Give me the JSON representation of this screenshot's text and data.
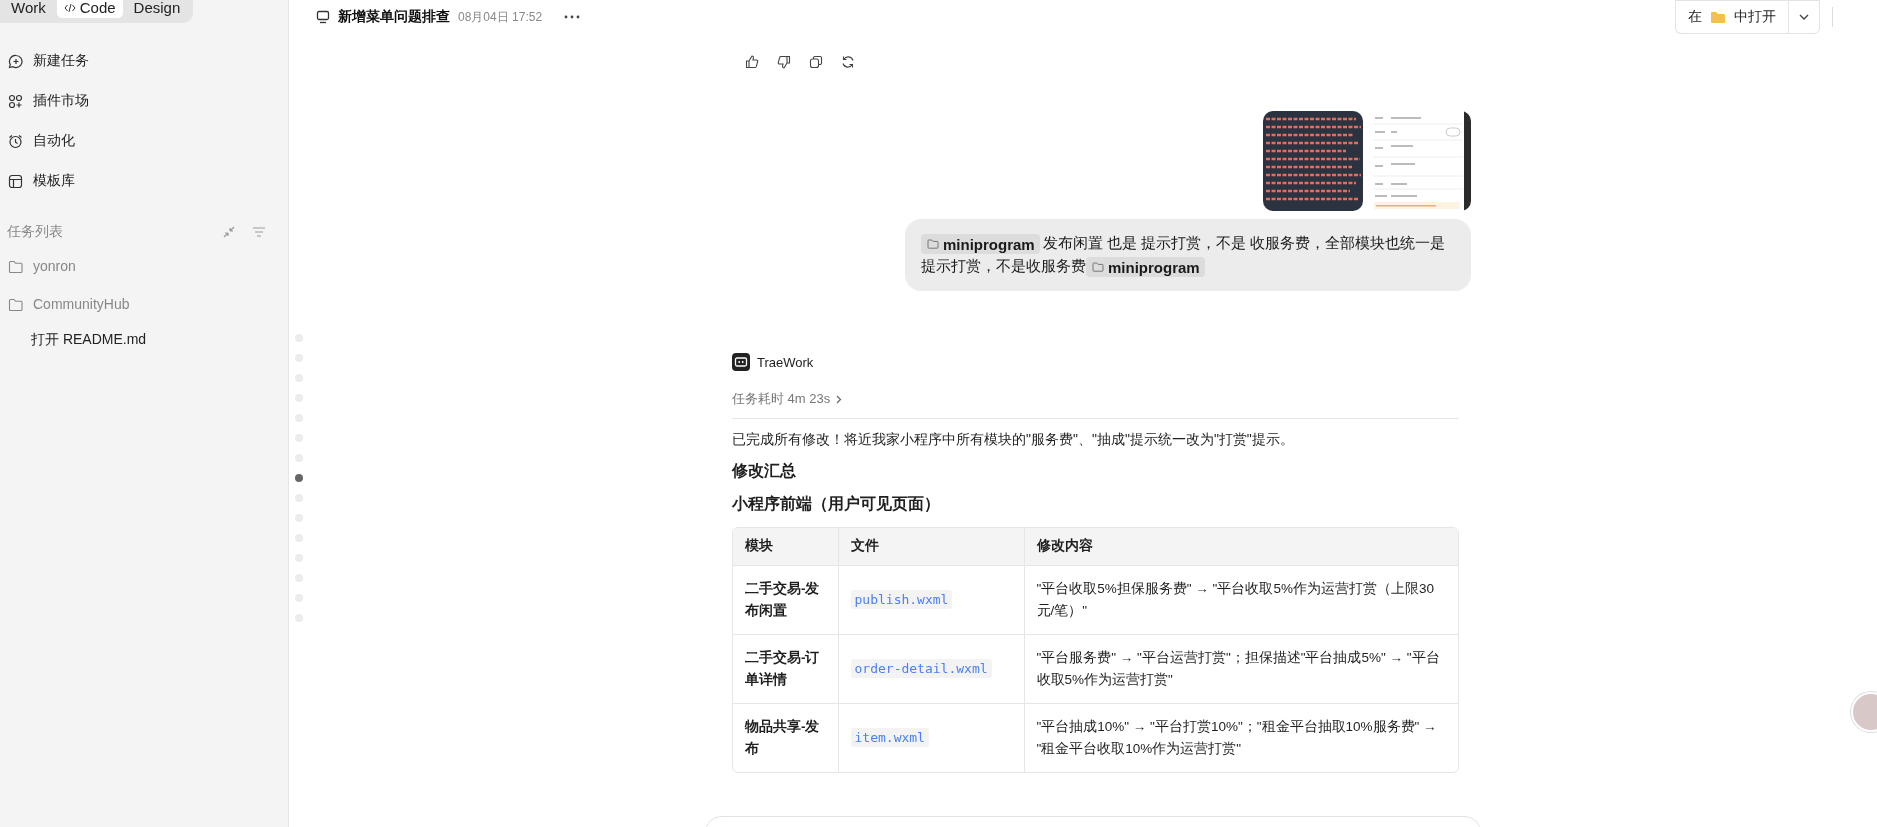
{
  "mode_tabs": [
    {
      "label": "Work",
      "selected": false,
      "kind": "plain"
    },
    {
      "label": "Code",
      "selected": true,
      "kind": "with_icon"
    },
    {
      "label": "Design",
      "selected": false,
      "kind": "plain"
    }
  ],
  "sidebar": {
    "nav_items": [
      {
        "label": "新建任务"
      },
      {
        "label": "插件市场"
      },
      {
        "label": "自动化"
      },
      {
        "label": "模板库"
      }
    ],
    "task_list": {
      "title": "任务列表",
      "items": [
        {
          "label": "yonron"
        },
        {
          "label": "CommunityHub",
          "children": [
            {
              "label": "打开 README.md"
            }
          ]
        }
      ]
    }
  },
  "header": {
    "title": "新增菜单问题排查",
    "time": "08月04日 17:52",
    "open_in": {
      "prefix": "在",
      "suffix": "中打开"
    }
  },
  "nav_dots": [
    {
      "selected": false
    },
    {
      "selected": false
    },
    {
      "selected": false
    },
    {
      "selected": false
    },
    {
      "selected": false
    },
    {
      "selected": false
    },
    {
      "selected": false
    },
    {
      "selected": true
    },
    {
      "selected": false
    },
    {
      "selected": false
    },
    {
      "selected": false
    },
    {
      "selected": false
    },
    {
      "selected": false
    },
    {
      "selected": false
    },
    {
      "selected": false
    }
  ],
  "user_message": {
    "parts": [
      {
        "kind": "folder_tag",
        "text": "miniprogram"
      },
      {
        "kind": "text",
        "text": "发布闲置 也是 提示打赏，不是 收服务费，全部模块也统一是提示打赏，不是收服务费"
      },
      {
        "kind": "folder_tag",
        "text": "miniprogram"
      }
    ]
  },
  "assistant": {
    "name": "TraeWork",
    "duration": "任务耗时 4m 23s",
    "summary": "已完成所有修改！将近我家小程序中所有模块的\"服务费\"、\"抽成\"提示统一改为\"打赏\"提示。",
    "headings": [
      "修改汇总",
      "小程序前端（用户可见页面）"
    ],
    "table": {
      "columns": [
        "模块",
        "文件",
        "修改内容"
      ],
      "rows": [
        {
          "module": "二手交易-发布闲置",
          "file": "publish.wxml",
          "change": "\"平台收取5%担保服务费\" → \"平台收取5%作为运营打赏（上限30元/笔）\""
        },
        {
          "module": "二手交易-订单详情",
          "file": "order-detail.wxml",
          "change": "\"平台服务费\" → \"平台运营打赏\"；担保描述\"平台抽成5%\" → \"平台收取5%作为运营打赏\""
        },
        {
          "module": "物品共享-发布",
          "file": "item.wxml",
          "change": "\"平台抽成10%\" → \"平台打赏10%\"；\"租金平台抽取10%服务费\" → \"租金平台收取10%作为运营打赏\""
        }
      ]
    }
  }
}
